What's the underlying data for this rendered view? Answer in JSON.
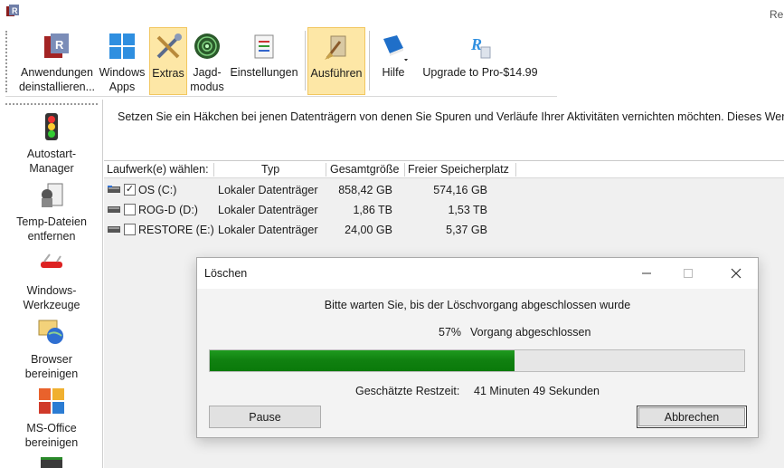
{
  "window": {
    "title_fragment": "Re"
  },
  "toolbar": {
    "items": [
      {
        "label": "Anwendungen deinstallieren...",
        "icon": "uninstall-apps-icon"
      },
      {
        "label": "Windows Apps",
        "icon": "windows-logo-icon"
      },
      {
        "label": "Extras",
        "icon": "tools-icon",
        "active": true
      },
      {
        "label": "Jagd-modus",
        "icon": "radar-icon"
      },
      {
        "label": "Einstellungen",
        "icon": "settings-checklist-icon"
      },
      {
        "label": "Ausführen",
        "icon": "broom-run-icon",
        "active": true
      },
      {
        "label": "Hilfe",
        "icon": "help-book-icon"
      },
      {
        "label": "Upgrade to Pro-$14.99",
        "icon": "upgrade-logo-icon"
      }
    ],
    "lines": {
      "apps_1": "Anwendungen",
      "apps_2": "deinstallieren...",
      "winapps_1": "Windows",
      "winapps_2": "Apps",
      "extras": "Extras",
      "jagd_1": "Jagd-",
      "jagd_2": "modus",
      "settings": "Einstellungen",
      "run": "Ausführen",
      "help": "Hilfe",
      "upgrade": "Upgrade to Pro-$14.99"
    }
  },
  "sidebar": {
    "items": [
      {
        "l1": "Autostart-",
        "l2": "Manager",
        "icon": "traffic-light-icon"
      },
      {
        "l1": "Temp-Dateien",
        "l2": "entfernen",
        "icon": "temp-files-icon"
      },
      {
        "l1": "Windows-",
        "l2": "Werkzeuge",
        "icon": "swiss-knife-icon"
      },
      {
        "l1": "Browser",
        "l2": "bereinigen",
        "icon": "browser-globe-icon"
      },
      {
        "l1": "MS-Office",
        "l2": "bereinigen",
        "icon": "office-icon"
      }
    ]
  },
  "main": {
    "instructions": "Setzen Sie ein Häkchen bei jenen Datenträgern von denen Sie Spuren und Verläufe Ihrer Aktivitäten vernichten möchten. Dieses Wer",
    "columns": [
      "Laufwerk(e) wählen:",
      "Typ",
      "Gesamtgröße",
      "Freier Speicherplatz"
    ],
    "drives": [
      {
        "name": "OS (C:)",
        "type": "Lokaler Datenträger",
        "total": "858,42 GB",
        "free": "574,16 GB",
        "checked": true
      },
      {
        "name": "ROG-D (D:)",
        "type": "Lokaler Datenträger",
        "total": "1,86 TB",
        "free": "1,53 TB",
        "checked": false
      },
      {
        "name": "RESTORE (E:)",
        "type": "Lokaler Datenträger",
        "total": "24,00 GB",
        "free": "5,37 GB",
        "checked": false
      }
    ]
  },
  "dialog": {
    "title": "Löschen",
    "message": "Bitte warten Sie, bis der Löschvorgang abgeschlossen wurde",
    "percent_text": "57%",
    "percent_label": "Vorgang abgeschlossen",
    "progress": 0.57,
    "eta_label": "Geschätzte Restzeit:",
    "eta_value": "41 Minuten 49 Sekunden",
    "pause_label": "Pause",
    "cancel_label": "Abbrechen"
  },
  "colors": {
    "progress_green": "#108010",
    "active_toolbar": "#fde7a6"
  }
}
